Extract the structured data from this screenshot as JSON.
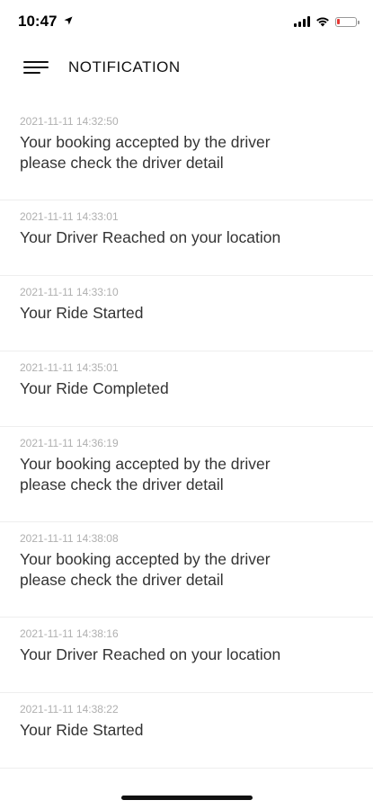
{
  "status_bar": {
    "time": "10:47",
    "icons": [
      "location-arrow-icon",
      "cellular-signal-icon",
      "wifi-icon",
      "battery-icon"
    ],
    "battery_level": 0.15,
    "battery_color": "#e53935"
  },
  "header": {
    "menu_icon": "hamburger-menu-icon",
    "title": "NOTIFICATION"
  },
  "notifications": [
    {
      "timestamp": "2021-11-11 14:32:50",
      "message": "Your booking accepted by the driver\nplease check the driver detail"
    },
    {
      "timestamp": "2021-11-11 14:33:01",
      "message": "Your Driver Reached on your location"
    },
    {
      "timestamp": "2021-11-11 14:33:10",
      "message": "Your Ride Started"
    },
    {
      "timestamp": "2021-11-11 14:35:01",
      "message": "Your Ride Completed"
    },
    {
      "timestamp": "2021-11-11 14:36:19",
      "message": "Your booking accepted by the driver\nplease check the driver detail"
    },
    {
      "timestamp": "2021-11-11 14:38:08",
      "message": "Your booking accepted by the driver\nplease check the driver detail"
    },
    {
      "timestamp": "2021-11-11 14:38:16",
      "message": "Your Driver Reached on your location"
    },
    {
      "timestamp": "2021-11-11 14:38:22",
      "message": "Your Ride Started"
    }
  ]
}
